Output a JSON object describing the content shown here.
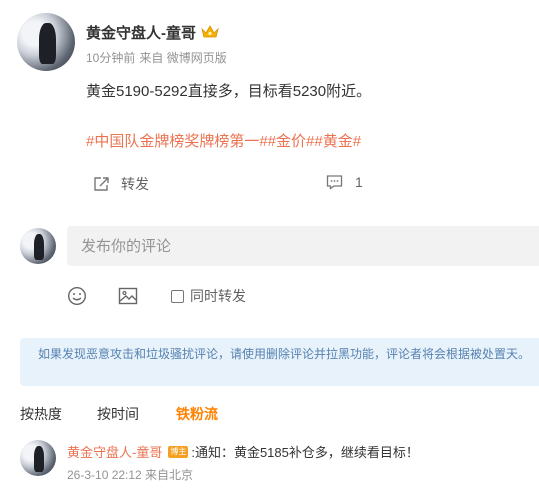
{
  "post": {
    "author": "黄金守盘人-童哥",
    "time": "10分钟前",
    "source": "来自 微博网页版",
    "text": "黄金5190-5292直接多，目标看5230附近。",
    "tags": "#中国队金牌榜奖牌榜第一##金价##黄金#",
    "forward_label": "转发",
    "comment_count": "1"
  },
  "composer": {
    "placeholder": "发布你的评论",
    "repost_label": "同时转发"
  },
  "notice": "如果发现恶意攻击和垃圾骚扰评论，请使用删除评论并拉黑功能，评论者将会根据被处置天。",
  "sort_tabs": {
    "hot": "按热度",
    "time": "按时间",
    "fans": "铁粉流"
  },
  "comment": {
    "author": "黄金守盘人-童哥",
    "badge": "博主",
    "text": ":通知：黄金5185补仓多，继续看目标！",
    "meta": "26-3-10 22:12 来自北京"
  },
  "colors": {
    "accent": "#eb7350",
    "tab_active": "#ff8200",
    "notice_bg": "#e8f2fb"
  },
  "icons": [
    "crown-icon",
    "forward-icon",
    "comment-icon",
    "emoji-icon",
    "image-icon"
  ]
}
